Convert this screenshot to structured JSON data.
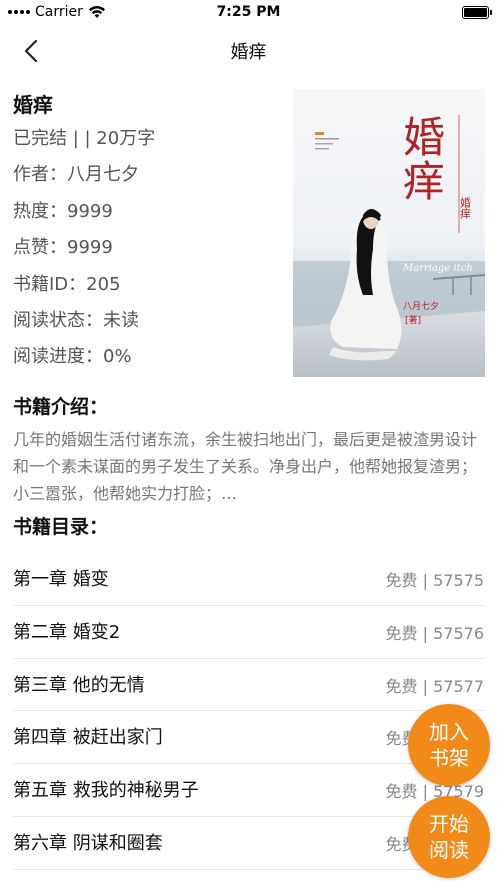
{
  "status_bar": {
    "carrier": "Carrier",
    "time": "7:25 PM"
  },
  "nav": {
    "title": "婚痒"
  },
  "book": {
    "title": "婚痒",
    "status": "已完结 | | 20万字",
    "author": "作者：八月七夕",
    "heat": "热度：9999",
    "likes": "点赞：9999",
    "book_id": "书籍ID：205",
    "read_status": "阅读状态：未读",
    "read_progress": "阅读进度：0%"
  },
  "cover": {
    "big_title": "婚痒",
    "small_title": "婚痒",
    "english_title": "Marriage itch",
    "author": "八月七夕",
    "author_note": "[著]",
    "accent_color": "#b22222"
  },
  "intro": {
    "heading": "书籍介绍：",
    "text": "几年的婚姻生活付诸东流，余生被扫地出门，最后更是被渣男设计和一个素未谋面的男子发生了关系。净身出户，他帮她报复渣男；小三嚣张，他帮她实力打脸；…"
  },
  "toc": {
    "heading": "书籍目录：",
    "chapters": [
      {
        "title": "第一章 婚变",
        "meta": "免费 | 57575"
      },
      {
        "title": "第二章 婚变2",
        "meta": "免费 | 57576"
      },
      {
        "title": "第三章 他的无情",
        "meta": "免费 | 57577"
      },
      {
        "title": "第四章 被赶出家门",
        "meta": "免费 | 57578"
      },
      {
        "title": "第五章 救我的神秘男子",
        "meta": "免费 | 57579"
      },
      {
        "title": "第六章 阴谋和圈套",
        "meta": "免费 | 57580"
      }
    ]
  },
  "actions": {
    "add_shelf": "加入书架",
    "start_read": "开始阅读",
    "accent_color": "#f28a1a"
  }
}
